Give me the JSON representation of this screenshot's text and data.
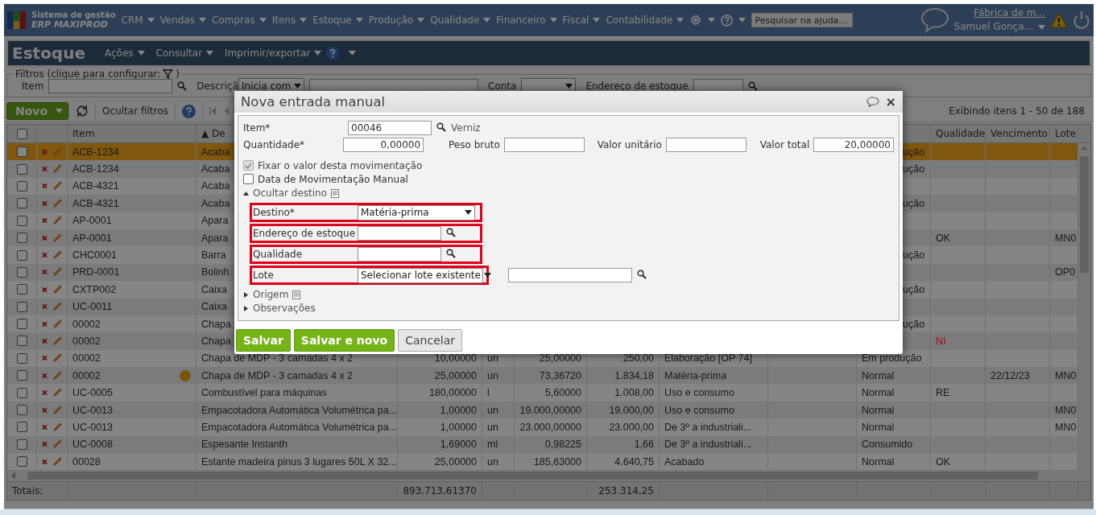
{
  "topbar": {
    "logo_line1": "Sistema de gestão",
    "logo_line2": "ERP MAXIPROD",
    "menus": [
      "CRM",
      "Vendas",
      "Compras",
      "Itens",
      "Estoque",
      "Produção",
      "Qualidade",
      "Financeiro",
      "Fiscal",
      "Contabilidade"
    ],
    "search": {
      "placeholder": "Pesquisar na ajuda..."
    },
    "company": "Fábrica de m...",
    "user": "Samuel Gonça..."
  },
  "page": {
    "title": "Estoque",
    "menus": [
      "Ações",
      "Consultar",
      "Imprimir/exportar"
    ]
  },
  "filters": {
    "legend_start": "Filtros (clique para configurar:",
    "legend_end": ")",
    "fields": [
      {
        "label": "Item",
        "kind": "lookup"
      },
      {
        "label": "Descriçã",
        "kind": "match",
        "option": "Inicia com"
      },
      {
        "label": "Conta",
        "kind": "select"
      },
      {
        "label": "Endereço de estoque",
        "kind": "lookup"
      }
    ]
  },
  "toolbar": {
    "new_button": "Novo",
    "hide_filters": "Ocultar filtros",
    "paging": "Exibindo itens 1 - 50 de 188"
  },
  "table": {
    "all_checked": false,
    "columns": [
      {
        "label": "Item"
      },
      {
        "label": "▲ De"
      },
      null,
      null,
      null,
      null,
      null,
      null,
      null,
      {
        "label": "Qualidade"
      },
      {
        "label": "Vencimento"
      },
      {
        "label": "Lote"
      }
    ],
    "rows": [
      {
        "selected": true,
        "checked": false,
        "alert": false,
        "cells": [
          "ACB-1234",
          "Acaba",
          null,
          null,
          null,
          null,
          null,
          null,
          {
            "text": "ução",
            "kind": "fragment"
          },
          null,
          null,
          null
        ]
      },
      {
        "selected": false,
        "checked": false,
        "alert": false,
        "cells": [
          "ACB-1234",
          "Acaba",
          null,
          null,
          null,
          null,
          null,
          null,
          {
            "text": "ução",
            "kind": "fragment"
          },
          null,
          null,
          null
        ]
      },
      {
        "selected": false,
        "checked": false,
        "alert": false,
        "cells": [
          "ACB-4321",
          "Acaba",
          null,
          null,
          null,
          null,
          null,
          null,
          null,
          null,
          null,
          null
        ]
      },
      {
        "selected": false,
        "checked": false,
        "alert": false,
        "cells": [
          "ACB-4321",
          "Acaba",
          null,
          null,
          null,
          null,
          null,
          null,
          {
            "text": "ução",
            "kind": "fragment"
          },
          null,
          null,
          null
        ]
      },
      {
        "selected": false,
        "checked": false,
        "alert": false,
        "cells": [
          "AP-0001",
          "Apara",
          null,
          null,
          null,
          null,
          null,
          null,
          null,
          null,
          null,
          null
        ]
      },
      {
        "selected": false,
        "checked": false,
        "alert": false,
        "cells": [
          "AP-0001",
          "Apara",
          null,
          null,
          null,
          null,
          null,
          null,
          null,
          "OK",
          null,
          "MN0"
        ]
      },
      {
        "selected": false,
        "checked": false,
        "alert": false,
        "cells": [
          "CHC0001",
          "Barra",
          null,
          null,
          null,
          null,
          null,
          null,
          {
            "text": "ução",
            "kind": "fragment"
          },
          null,
          null,
          null
        ]
      },
      {
        "selected": false,
        "checked": false,
        "alert": false,
        "cells": [
          "PRD-0001",
          "Bolinh",
          null,
          null,
          null,
          null,
          null,
          null,
          null,
          null,
          null,
          "OP0"
        ]
      },
      {
        "selected": false,
        "checked": false,
        "alert": false,
        "cells": [
          "CXTP002",
          "Caixa",
          null,
          null,
          null,
          null,
          null,
          null,
          {
            "text": "ução",
            "kind": "fragment"
          },
          null,
          null,
          null
        ]
      },
      {
        "selected": false,
        "checked": false,
        "alert": false,
        "cells": [
          "UC-0011",
          "Caixa",
          null,
          null,
          null,
          null,
          null,
          null,
          null,
          null,
          null,
          null
        ]
      },
      {
        "selected": false,
        "checked": false,
        "alert": false,
        "cells": [
          "00002",
          "Chapa",
          null,
          null,
          null,
          null,
          null,
          null,
          {
            "text": "ução",
            "kind": "fragment"
          },
          null,
          null,
          null
        ]
      },
      {
        "selected": false,
        "checked": false,
        "alert": false,
        "cells": [
          "00002",
          "Chapa",
          null,
          null,
          null,
          null,
          null,
          null,
          null,
          {
            "text": "NI",
            "color": "#a0101c"
          },
          null,
          null
        ]
      },
      {
        "selected": false,
        "checked": false,
        "alert": false,
        "cells": [
          "00002",
          "Chapa de MDP - 3 camadas 4 x 2",
          "10,00000",
          "un",
          "25,00000",
          "250,00",
          "Elaboração [OP 74]",
          null,
          "Em produção",
          null,
          null,
          null
        ]
      },
      {
        "selected": false,
        "checked": false,
        "alert": true,
        "cells": [
          "00002",
          "Chapa de MDP - 3 camadas 4 x 2",
          "25,00000",
          "un",
          "73,36720",
          "1.834,18",
          "Matéria-prima",
          null,
          "Normal",
          null,
          "22/12/23",
          "MN0"
        ]
      },
      {
        "selected": false,
        "checked": false,
        "alert": false,
        "cells": [
          "UC-0005",
          "Combustível para máquinas",
          "180,00000",
          "l",
          "5,60000",
          "1.008,00",
          "Uso e consumo",
          null,
          "Normal",
          "RE",
          null,
          null
        ]
      },
      {
        "selected": false,
        "checked": false,
        "alert": false,
        "cells": [
          "UC-0013",
          "Empacotadora Automática Volumétrica pa...",
          "1,00000",
          "un",
          "19.000,00000",
          "19.000,00",
          "Uso e consumo",
          null,
          "Normal",
          null,
          null,
          "MN0"
        ]
      },
      {
        "selected": false,
        "checked": false,
        "alert": false,
        "cells": [
          "UC-0013",
          "Empacotadora Automática Volumétrica pa...",
          "1,00000",
          "un",
          "23.000,00000",
          "23.000,00",
          "De 3º a industriali...",
          null,
          "Normal",
          null,
          null,
          "MN0"
        ]
      },
      {
        "selected": false,
        "checked": false,
        "alert": false,
        "cells": [
          "UC-0008",
          "Espesante Instanth",
          "1,69000",
          "ml",
          "0,98225",
          "1,66",
          "De 3º a industriali...",
          null,
          "Consumido",
          null,
          null,
          null
        ]
      },
      {
        "selected": false,
        "checked": false,
        "alert": false,
        "cells": [
          "00028",
          "Estante madeira pinus 3 lugares 50L X 32...",
          "25,00000",
          "un",
          "185,63000",
          "4.640,75",
          "Acabado",
          null,
          "Normal",
          "OK",
          null,
          null
        ]
      }
    ],
    "totals": {
      "label": "Totais:",
      "quantity": "893.713,61370",
      "total_value": "253.314,25"
    }
  },
  "dialog": {
    "title": "Nova entrada manual",
    "close": "×",
    "item": {
      "label": "Item*",
      "value": "00046",
      "name": "Verniz"
    },
    "amounts": [
      {
        "label": "Quantidade*",
        "value": "0,00000"
      },
      {
        "label": "Peso bruto"
      },
      {
        "label": "Valor unitário"
      },
      {
        "label": "Valor total",
        "value": "20,00000"
      }
    ],
    "options": [
      {
        "label": "Fixar o valor desta movimentação",
        "checked": true,
        "disabled": true
      },
      {
        "label": "Data de Movimentação Manual",
        "checked": false,
        "disabled": false
      }
    ],
    "sections": [
      {
        "title": "Ocultar destino",
        "expanded": true,
        "notes_icon": true,
        "fields": [
          {
            "label": "Destino*",
            "kind": "select",
            "value": "Matéria-prima",
            "highlighted": true
          },
          {
            "label": "Endereço de estoque",
            "kind": "lookup",
            "highlighted": true
          },
          {
            "label": "Qualidade",
            "kind": "lookup",
            "highlighted": true
          },
          {
            "label": "Lote",
            "kind": "select-lookup",
            "value": "Selecionar lote existente",
            "highlighted": true
          }
        ]
      },
      {
        "title": "Origem",
        "expanded": false,
        "notes_icon": true
      },
      {
        "title": "Observações",
        "expanded": false,
        "notes_icon": false
      }
    ],
    "buttons": [
      {
        "label": "Salvar",
        "kind": "primary"
      },
      {
        "label": "Salvar e novo",
        "kind": "primary"
      },
      {
        "label": "Cancelar",
        "kind": "secondary"
      }
    ]
  }
}
